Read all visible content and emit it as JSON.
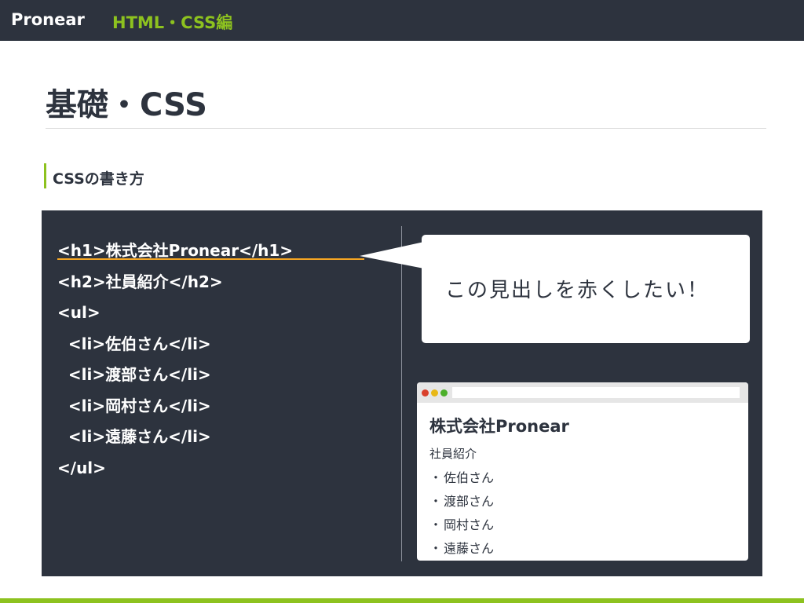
{
  "header": {
    "brand": "Pronear",
    "section": "HTML・CSS編"
  },
  "page": {
    "title": "基礎・CSS",
    "subheading": "CSSの書き方"
  },
  "code_lines": [
    "<h1>株式会社Pronear</h1>",
    "<h2>社員紹介</h2>",
    "<ul>",
    "  <li>佐伯さん</li>",
    "  <li>渡部さん</li>",
    "  <li>岡村さん</li>",
    "  <li>遠藤さん</li>",
    "</ul>"
  ],
  "callout": {
    "text": "この見出しを赤くしたい！"
  },
  "preview": {
    "h1": "株式会社Pronear",
    "h2": "社員紹介",
    "bullet": "・",
    "items": [
      "佐伯さん",
      "渡部さん",
      "岡村さん",
      "遠藤さん"
    ]
  },
  "colors": {
    "accent": "#8dc21f",
    "dark": "#2d333e",
    "highlight": "#f5a623"
  }
}
